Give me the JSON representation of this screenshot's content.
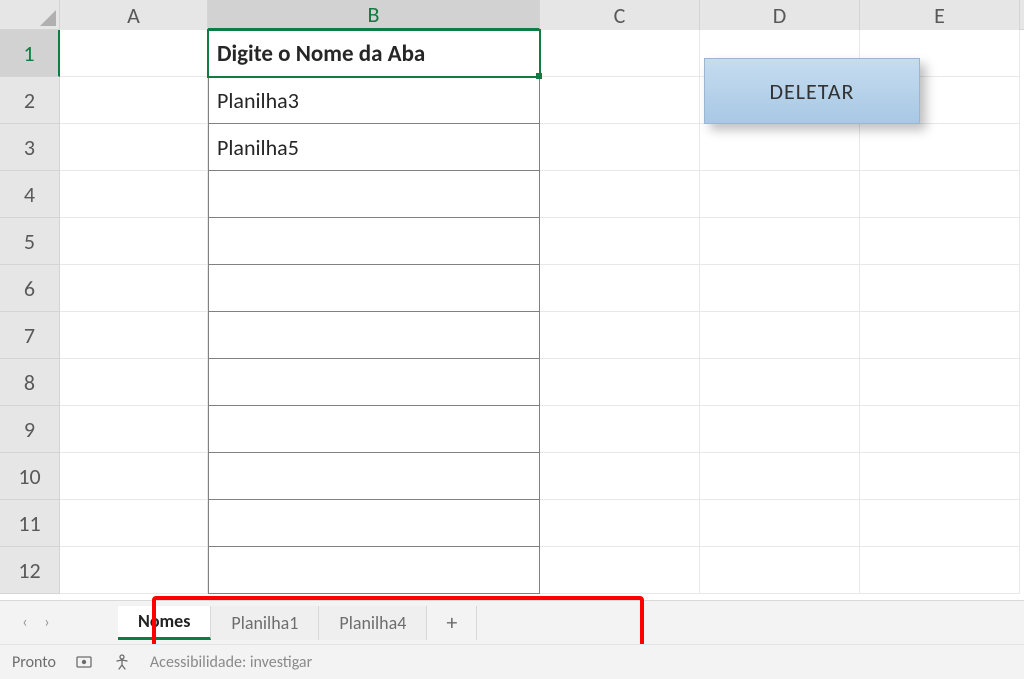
{
  "columns": [
    "A",
    "B",
    "C",
    "D",
    "E"
  ],
  "selected_column": "B",
  "selected_row": 1,
  "row_numbers": [
    1,
    2,
    3,
    4,
    5,
    6,
    7,
    8,
    9,
    10,
    11,
    12
  ],
  "table": {
    "header": "Digite o Nome da Aba",
    "rows": [
      "Planilha3",
      "Planilha5",
      "",
      "",
      "",
      "",
      "",
      "",
      "",
      "",
      ""
    ]
  },
  "button": {
    "label": "DELETAR"
  },
  "sheet_tabs": {
    "nav_prev": "‹",
    "nav_next": "›",
    "items": [
      {
        "label": "Nomes",
        "active": true
      },
      {
        "label": "Planilha1",
        "active": false
      },
      {
        "label": "Planilha4",
        "active": false
      }
    ],
    "add": "+"
  },
  "status": {
    "ready": "Pronto",
    "accessibility": "Acessibilidade: investigar"
  }
}
